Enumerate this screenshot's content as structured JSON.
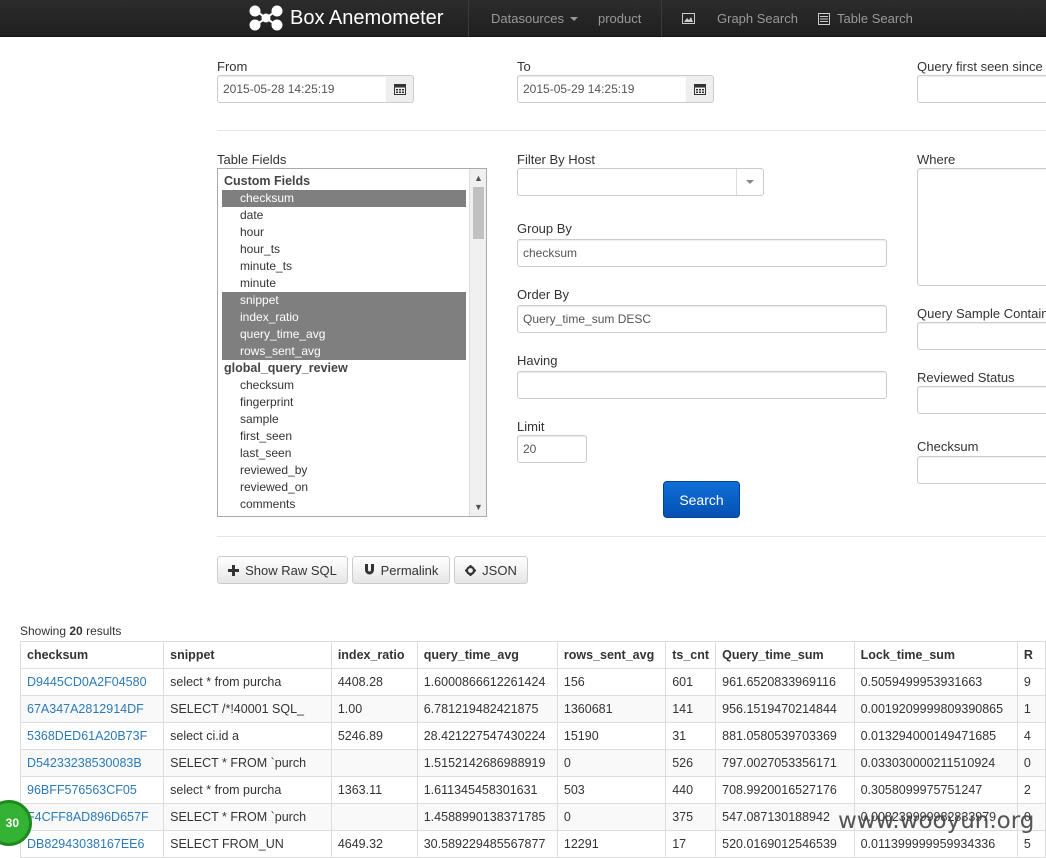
{
  "navbar": {
    "brand": "Box Anemometer",
    "datasources_label": "Datasources",
    "datasource_current": "product",
    "graph_search": "Graph Search",
    "table_search": "Table Search"
  },
  "form": {
    "from_label": "From",
    "from_value": "2015-05-28 14:25:19",
    "to_label": "To",
    "to_value": "2015-05-29 14:25:19",
    "first_seen_label": "Query first seen since",
    "table_fields_label": "Table Fields",
    "filter_host_label": "Filter By Host",
    "where_label": "Where",
    "group_by_label": "Group By",
    "group_by_value": "checksum",
    "order_by_label": "Order By",
    "order_by_value": "Query_time_sum DESC",
    "having_label": "Having",
    "limit_label": "Limit",
    "limit_value": "20",
    "sample_contains_label": "Query Sample Contains",
    "reviewed_status_label": "Reviewed Status",
    "checksum_label": "Checksum",
    "search_button": "Search"
  },
  "table_fields": {
    "groups": [
      {
        "name": "Custom Fields",
        "items": [
          {
            "label": "checksum",
            "selected": true
          },
          {
            "label": "date",
            "selected": false
          },
          {
            "label": "hour",
            "selected": false
          },
          {
            "label": "hour_ts",
            "selected": false
          },
          {
            "label": "minute_ts",
            "selected": false
          },
          {
            "label": "minute",
            "selected": false
          },
          {
            "label": "snippet",
            "selected": true
          },
          {
            "label": "index_ratio",
            "selected": true
          },
          {
            "label": "query_time_avg",
            "selected": true
          },
          {
            "label": "rows_sent_avg",
            "selected": true
          }
        ]
      },
      {
        "name": "global_query_review",
        "items": [
          {
            "label": "checksum",
            "selected": false
          },
          {
            "label": "fingerprint",
            "selected": false
          },
          {
            "label": "sample",
            "selected": false
          },
          {
            "label": "first_seen",
            "selected": false
          },
          {
            "label": "last_seen",
            "selected": false
          },
          {
            "label": "reviewed_by",
            "selected": false
          },
          {
            "label": "reviewed_on",
            "selected": false
          },
          {
            "label": "comments",
            "selected": false
          }
        ]
      }
    ]
  },
  "actions": {
    "raw_sql": "Show Raw SQL",
    "permalink": "Permalink",
    "json": "JSON"
  },
  "results": {
    "showing_prefix": "Showing",
    "count": "20",
    "showing_suffix": "results",
    "columns": [
      "checksum",
      "snippet",
      "index_ratio",
      "query_time_avg",
      "rows_sent_avg",
      "ts_cnt",
      "Query_time_sum",
      "Lock_time_sum",
      "R"
    ],
    "rows": [
      [
        "D9445CD0A2F04580",
        "select * from purcha",
        "4408.28",
        "1.6000866612261424",
        "156",
        "601",
        "961.6520833969116",
        "0.5059499953931663",
        "9"
      ],
      [
        "67A347A2812914DF",
        "SELECT /*!40001 SQL_",
        "1.00",
        "6.781219482421875",
        "1360681",
        "141",
        "956.1519470214844",
        "0.0019209999809390865",
        "1"
      ],
      [
        "5368DED61A20B73F",
        "select ci.id a",
        "5246.89",
        "28.421227547430224",
        "15190",
        "31",
        "881.0580539703369",
        "0.013294000149471685",
        "4"
      ],
      [
        "D54233238530083B",
        "SELECT * FROM `purch",
        "",
        "1.5152142686988919",
        "0",
        "526",
        "797.0027053356171",
        "0.033030000211510924",
        "0"
      ],
      [
        "96BFF576563CF05",
        "select * from purcha",
        "1363.11",
        "1.611345458301631",
        "503",
        "440",
        "708.9920016527176",
        "0.3058099975751247",
        "2"
      ],
      [
        "F4CFF8AD896D657F",
        "SELECT * FROM `purch",
        "",
        "1.4588990138371785",
        "0",
        "375",
        "547.087130188942",
        "0.008239999982833979",
        "0"
      ],
      [
        "DB82943038167EE6",
        "SELECT FROM_UN",
        "4649.32",
        "30.589229485567877",
        "12291",
        "17",
        "520.0169012546539",
        "0.011399999959934336",
        "5"
      ]
    ]
  },
  "watermark": "www.wooyun.org",
  "badge": "30",
  "colors": {
    "navbar": "#222222",
    "selected_item": "#7f7f7f",
    "primary_button": "#0a62c9",
    "link": "#2a7ab8"
  }
}
